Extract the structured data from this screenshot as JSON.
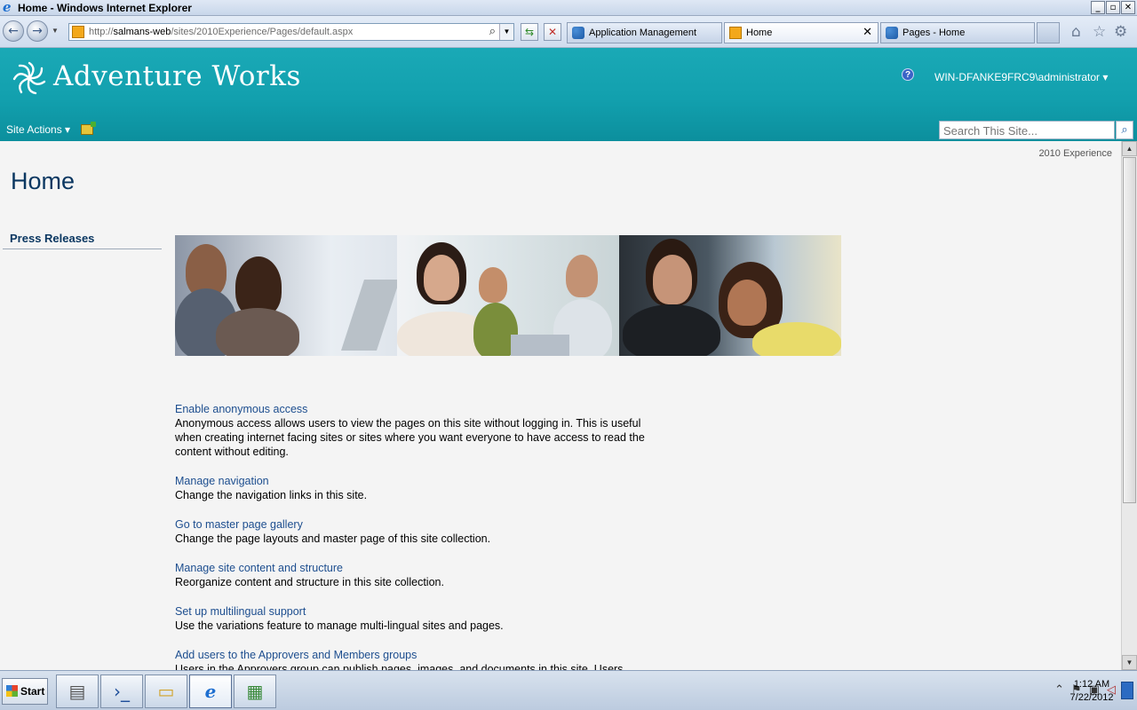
{
  "window": {
    "title": "Home - Windows Internet Explorer",
    "controls": [
      "_",
      "▫",
      "✕"
    ]
  },
  "browser": {
    "url_prefix": "http://",
    "url_host": "salmans-web",
    "url_path": "/sites/2010Experience/Pages/default.aspx",
    "tabs": [
      {
        "label": "Application Management",
        "icon": "sharepoint-icon"
      },
      {
        "label": "Home",
        "icon": "page-icon",
        "close": "✕"
      },
      {
        "label": "Pages - Home",
        "icon": "sharepoint-icon"
      }
    ]
  },
  "site": {
    "title": "Adventure Works",
    "help": "?",
    "user": "WIN-DFANKE9FRC9\\administrator",
    "site_actions": "Site Actions",
    "search_placeholder": "Search This Site...",
    "breadcrumb": "2010 Experience"
  },
  "page": {
    "title": "Home",
    "left_nav": [
      "Press Releases"
    ]
  },
  "tasks": [
    {
      "link": "Enable anonymous access",
      "desc": "Anonymous access allows users to view the pages on this site without logging in. This is useful when creating internet facing sites or sites where you want everyone to have access to read the content without editing."
    },
    {
      "link": "Manage navigation",
      "desc": "Change the navigation links in this site."
    },
    {
      "link": "Go to master page gallery",
      "desc": "Change the page layouts and master page of this site collection."
    },
    {
      "link": "Manage site content and structure",
      "desc": "Reorganize content and structure in this site collection."
    },
    {
      "link": "Set up multilingual support",
      "desc": "Use the variations feature to manage multi-lingual sites and pages."
    },
    {
      "link": "Add users to the Approvers and Members groups",
      "desc": "Users in the Approvers group can publish pages, images, and documents in this site. Users"
    }
  ],
  "taskbar": {
    "start": "Start",
    "time": "1:12 AM",
    "date": "7/22/2012"
  },
  "colors": {
    "header_teal": "#12a0ae",
    "title_blue": "#0b3761",
    "link_blue": "#1d4e8f"
  }
}
